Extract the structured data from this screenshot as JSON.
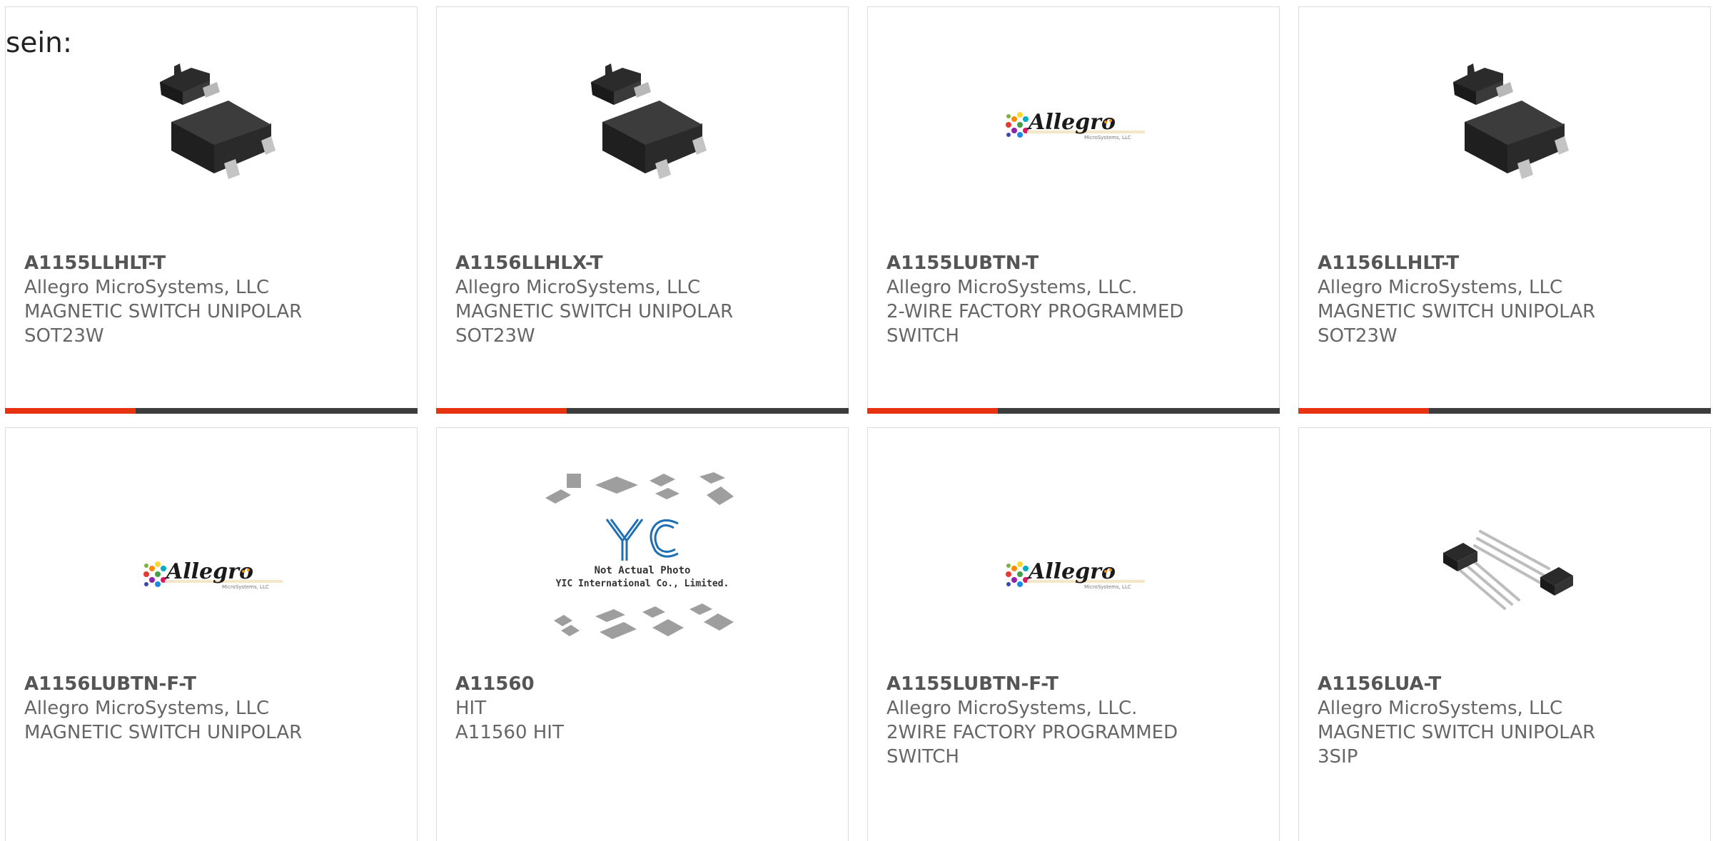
{
  "page": {
    "lead_text": "sein:"
  },
  "colors": {
    "accent": "#e63312",
    "bar": "#3d3d3d",
    "border": "#dcdcdc",
    "text": "#666666"
  },
  "logo": {
    "brand": "Allegro",
    "sub": "MicroSystems, LLC"
  },
  "placeholder": {
    "not_actual": "Not Actual Photo",
    "company": "YIC International Co., Limited."
  },
  "products": [
    {
      "part": "A1155LLHLT-T",
      "manufacturer": "Allegro MicroSystems, LLC",
      "description": [
        "MAGNETIC SWITCH UNIPOLAR",
        "SOT23W"
      ],
      "image": "sot23-package"
    },
    {
      "part": "A1156LLHLX-T",
      "manufacturer": "Allegro MicroSystems, LLC",
      "description": [
        "MAGNETIC SWITCH UNIPOLAR",
        "SOT23W"
      ],
      "image": "sot23-package"
    },
    {
      "part": "A1155LUBTN-T",
      "manufacturer": "Allegro MicroSystems, LLC.",
      "description": [
        "2-WIRE FACTORY PROGRAMMED",
        "SWITCH"
      ],
      "image": "allegro-logo"
    },
    {
      "part": "A1156LLHLT-T",
      "manufacturer": "Allegro MicroSystems, LLC",
      "description": [
        "MAGNETIC SWITCH UNIPOLAR",
        "SOT23W"
      ],
      "image": "sot23-package"
    },
    {
      "part": "A1156LUBTN-F-T",
      "manufacturer": "Allegro MicroSystems, LLC",
      "description": [
        "MAGNETIC SWITCH UNIPOLAR",
        ""
      ],
      "image": "allegro-logo"
    },
    {
      "part": "A11560",
      "manufacturer": "HIT",
      "description": [
        "A11560 HIT",
        ""
      ],
      "image": "yic-placeholder"
    },
    {
      "part": "A1155LUBTN-F-T",
      "manufacturer": "Allegro MicroSystems, LLC.",
      "description": [
        "2WIRE FACTORY PROGRAMMED",
        "SWITCH"
      ],
      "image": "allegro-logo"
    },
    {
      "part": "A1156LUA-T",
      "manufacturer": "Allegro MicroSystems, LLC",
      "description": [
        "MAGNETIC SWITCH UNIPOLAR",
        "3SIP"
      ],
      "image": "sip3-package"
    }
  ]
}
